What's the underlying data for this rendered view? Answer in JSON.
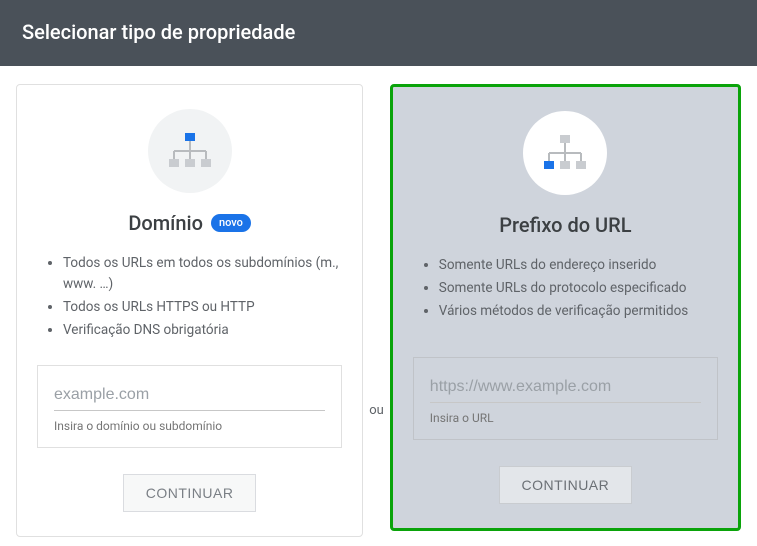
{
  "header": {
    "title": "Selecionar tipo de propriedade"
  },
  "separator": {
    "label": "ou"
  },
  "cards": {
    "domain": {
      "title": "Domínio",
      "badge": "novo",
      "features": [
        "Todos os URLs em todos os subdomínios (m., www. …)",
        "Todos os URLs HTTPS ou HTTP",
        "Verificação DNS obrigatória"
      ],
      "input": {
        "placeholder": "example.com",
        "helper": "Insira o domínio ou subdomínio"
      },
      "button": "CONTINUAR"
    },
    "prefix": {
      "title": "Prefixo do URL",
      "features": [
        "Somente URLs do endereço inserido",
        "Somente URLs do protocolo especificado",
        "Vários métodos de verificação permitidos"
      ],
      "input": {
        "placeholder": "https://www.example.com",
        "helper": "Insira o URL"
      },
      "button": "CONTINUAR"
    }
  },
  "colors": {
    "accent": "#1a73e8",
    "highlight": "#0aa30a"
  }
}
